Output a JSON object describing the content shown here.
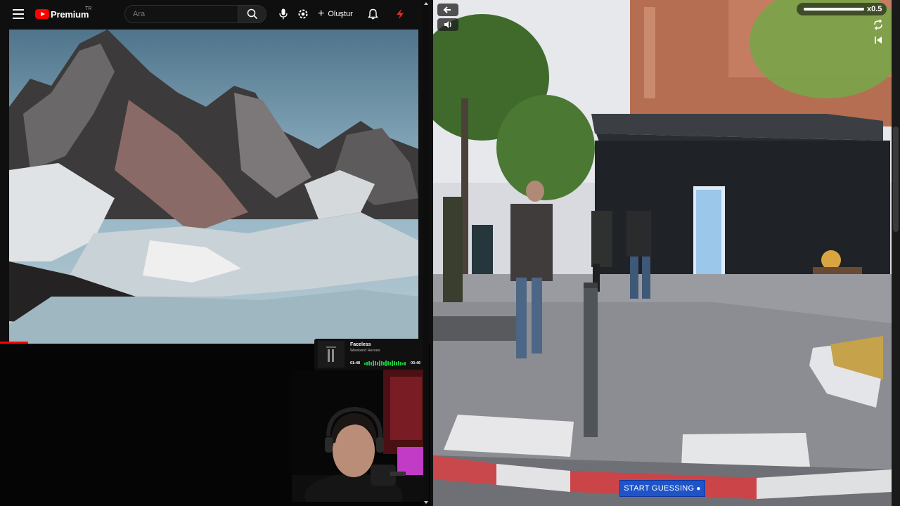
{
  "youtube": {
    "brand": "Premium",
    "region": "TR",
    "search_placeholder": "Ara",
    "create_label": "Oluştur"
  },
  "now_playing": {
    "title": "Faceless",
    "artist": "Weekend Heroes",
    "elapsed": "01:48",
    "duration": "03:46"
  },
  "streetview": {
    "zoom_label": "x0.5",
    "start_button_label": "START GUESSING"
  },
  "colors": {
    "youtube_red": "#ff0000",
    "accent_blue": "#1e54c8",
    "equalizer_green": "#21c442"
  },
  "icons": [
    "menu-icon",
    "search-icon",
    "microphone-icon",
    "magic-wand-icon",
    "plus-icon",
    "bell-icon",
    "lightning-icon",
    "back-arrow-icon",
    "volume-icon",
    "refresh-icon",
    "rewind-icon",
    "map-pin-icon"
  ]
}
